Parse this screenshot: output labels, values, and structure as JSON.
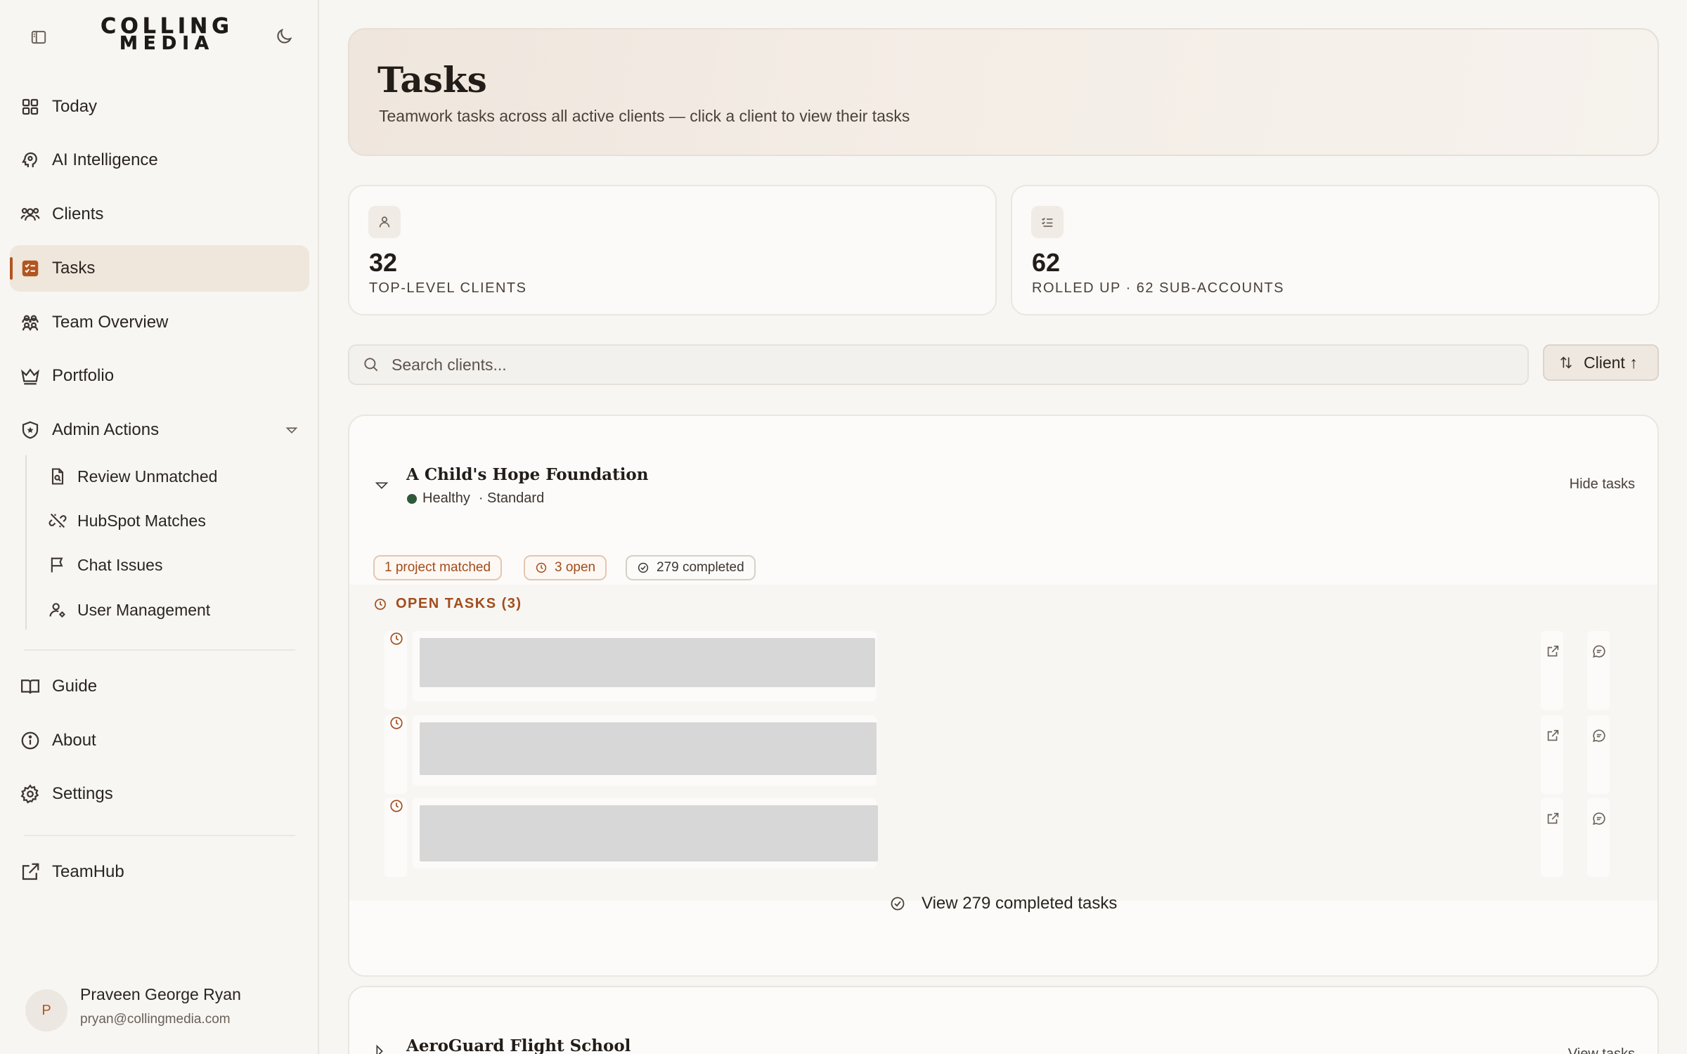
{
  "brand": {
    "line1": "COLLING",
    "line2": "MEDIA"
  },
  "sidebar": {
    "nav": [
      {
        "label": "Today",
        "icon": "grid-icon"
      },
      {
        "label": "AI Intelligence",
        "icon": "brain-head-icon"
      },
      {
        "label": "Clients",
        "icon": "users-icon"
      },
      {
        "label": "Tasks",
        "icon": "checklist-icon",
        "active": true
      },
      {
        "label": "Team Overview",
        "icon": "team-icon"
      },
      {
        "label": "Portfolio",
        "icon": "crown-icon"
      },
      {
        "label": "Admin Actions",
        "icon": "shield-star-icon",
        "expanded": true
      }
    ],
    "admin_sub": [
      {
        "label": "Review Unmatched",
        "icon": "file-search-icon"
      },
      {
        "label": "HubSpot Matches",
        "icon": "unlink-icon"
      },
      {
        "label": "Chat Issues",
        "icon": "flag-icon"
      },
      {
        "label": "User Management",
        "icon": "user-cog-icon"
      }
    ],
    "bottom_nav": [
      {
        "label": "Guide",
        "icon": "book-icon"
      },
      {
        "label": "About",
        "icon": "info-icon"
      },
      {
        "label": "Settings",
        "icon": "gear-icon"
      }
    ],
    "external": {
      "label": "TeamHub",
      "icon": "external-link-icon"
    },
    "user": {
      "initial": "P",
      "name": "Praveen George Ryan",
      "email": "pryan@collingmedia.com"
    }
  },
  "header": {
    "title": "Tasks",
    "subtitle": "Teamwork tasks across all active clients — click a client to view their tasks"
  },
  "stats": [
    {
      "value": "32",
      "label": "TOP-LEVEL CLIENTS",
      "icon": "user-icon"
    },
    {
      "value": "62",
      "label": "ROLLED UP · 62 SUB-ACCOUNTS",
      "icon": "list-check-icon"
    }
  ],
  "search": {
    "placeholder": "Search clients...",
    "value": ""
  },
  "sort": {
    "label": "Client ↑"
  },
  "clients": [
    {
      "name": "A Child's Hope Foundation",
      "health": "Healthy",
      "tier": "· Standard",
      "toggle_label": "Hide tasks",
      "pills": {
        "matched": "1 project matched",
        "open": "3 open",
        "completed": "279 completed"
      },
      "open_header": "OPEN TASKS (3)",
      "view_completed": "View 279 completed tasks",
      "health_color": "#2f5a3a"
    },
    {
      "name": "AeroGuard Flight School",
      "toggle_label": "View tasks"
    }
  ],
  "colors": {
    "accent": "#b3551f",
    "active_bg": "#efe6dc",
    "healthy": "#2f5a3a"
  }
}
